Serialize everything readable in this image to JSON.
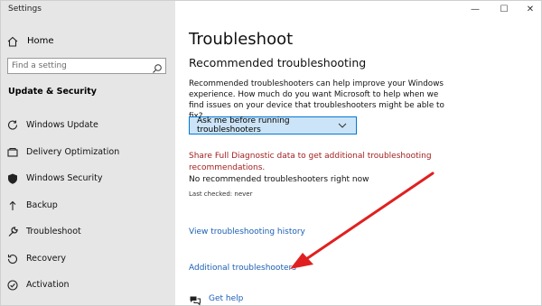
{
  "window": {
    "title": "Settings",
    "controls": {
      "minimize": "—",
      "maximize": "☐",
      "close": "✕"
    }
  },
  "sidebar": {
    "home_label": "Home",
    "search": {
      "placeholder": "Find a setting"
    },
    "section_title": "Update & Security",
    "items": [
      {
        "label": "Windows Update",
        "icon": "refresh-icon"
      },
      {
        "label": "Delivery Optimization",
        "icon": "delivery-icon"
      },
      {
        "label": "Windows Security",
        "icon": "shield-icon"
      },
      {
        "label": "Backup",
        "icon": "backup-icon"
      },
      {
        "label": "Troubleshoot",
        "icon": "wrench-icon"
      },
      {
        "label": "Recovery",
        "icon": "recovery-icon"
      },
      {
        "label": "Activation",
        "icon": "activation-icon"
      }
    ]
  },
  "main": {
    "title": "Troubleshoot",
    "subtitle": "Recommended troubleshooting",
    "description": "Recommended troubleshooters can help improve your Windows experience. How much do you want Microsoft to help when we find issues on your device that troubleshooters might be able to fix?",
    "dropdown_value": "Ask me before running troubleshooters",
    "diagnostic_link": "Share Full Diagnostic data to get additional troubleshooting recommendations.",
    "no_recommended": "No recommended troubleshooters right now",
    "last_checked": "Last checked: never",
    "history_link": "View troubleshooting history",
    "additional_link": "Additional troubleshooters",
    "get_help": "Get help"
  },
  "colors": {
    "sidebar_bg": "#e6e6e6",
    "accent_blue": "#0078d7",
    "link_blue": "#1a5fb4",
    "link_red": "#a32020",
    "arrow_red": "#e02020"
  }
}
